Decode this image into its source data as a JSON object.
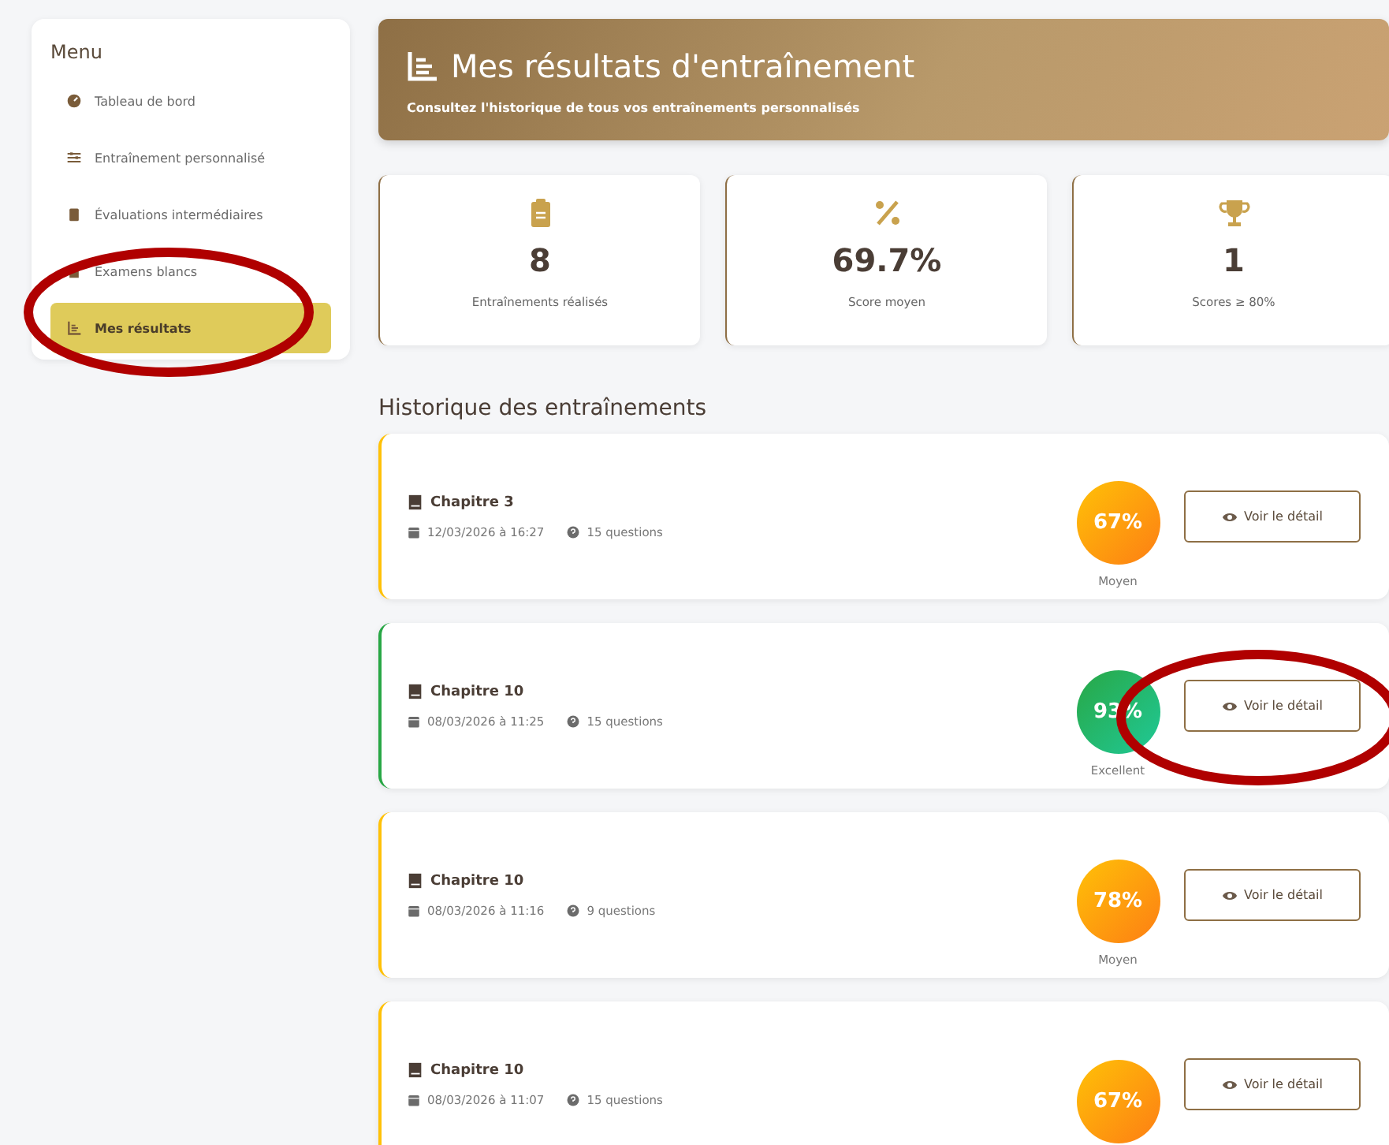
{
  "sidebar": {
    "title": "Menu",
    "items": [
      {
        "label": "Tableau de bord",
        "selected": false
      },
      {
        "label": "Entraînement personnalisé",
        "selected": false
      },
      {
        "label": "Évaluations intermédiaires",
        "selected": false
      },
      {
        "label": "Examens blancs",
        "selected": false
      },
      {
        "label": "Mes résultats",
        "selected": true
      }
    ]
  },
  "header": {
    "title": "Mes résultats d'entraînement",
    "subtitle": "Consultez l'historique de tous vos entraînements personnalisés"
  },
  "stats": [
    {
      "value": "8",
      "label": "Entraînements réalisés"
    },
    {
      "value": "69.7%",
      "label": "Score moyen"
    },
    {
      "value": "1",
      "label": "Scores ≥ 80%"
    }
  ],
  "history": {
    "title": "Historique des entraînements",
    "items": [
      {
        "title": "Chapitre 3",
        "date": "12/03/2026 à 16:27",
        "questions": "15 questions",
        "score": "67%",
        "grade": "Moyen",
        "color": "#ffc107",
        "button": "Voir le détail"
      },
      {
        "title": "Chapitre 10",
        "date": "08/03/2026 à 11:25",
        "questions": "15 questions",
        "score": "93%",
        "grade": "Excellent",
        "color": "#28a745",
        "button": "Voir le détail"
      },
      {
        "title": "Chapitre 10",
        "date": "08/03/2026 à 11:16",
        "questions": "9 questions",
        "score": "78%",
        "grade": "Moyen",
        "color": "#ffc107",
        "button": "Voir le détail"
      },
      {
        "title": "Chapitre 10",
        "date": "08/03/2026 à 11:07",
        "questions": "15 questions",
        "score": "67%",
        "color": "#ffc107",
        "button": "Voir le détail"
      }
    ]
  }
}
